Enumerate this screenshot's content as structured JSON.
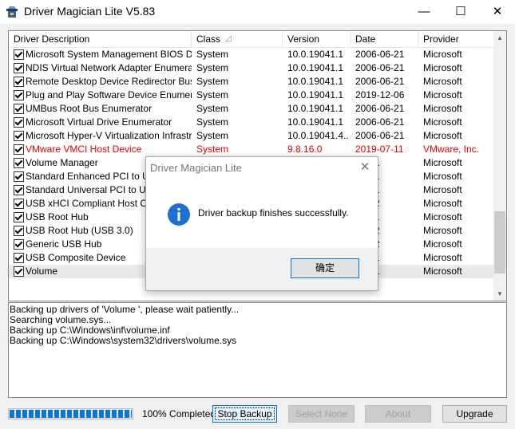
{
  "window": {
    "title": "Driver Magician Lite V5.83",
    "minimize_glyph": "—",
    "maximize_glyph": "☐",
    "close_glyph": "✕"
  },
  "list": {
    "headers": {
      "desc": "Driver Description",
      "class": "Class",
      "version": "Version",
      "date": "Date",
      "provider": "Provider"
    },
    "sort_glyph": "◿",
    "rows": [
      {
        "desc": "Microsoft System Management BIOS Driver",
        "class": "System",
        "version": "10.0.19041.1",
        "date": "2006-06-21",
        "provider": "Microsoft"
      },
      {
        "desc": "NDIS Virtual Network Adapter Enumerator",
        "class": "System",
        "version": "10.0.19041.1",
        "date": "2006-06-21",
        "provider": "Microsoft"
      },
      {
        "desc": "Remote Desktop Device Redirector Bus",
        "class": "System",
        "version": "10.0.19041.1",
        "date": "2006-06-21",
        "provider": "Microsoft"
      },
      {
        "desc": "Plug and Play Software Device Enumerator",
        "class": "System",
        "version": "10.0.19041.1",
        "date": "2019-12-06",
        "provider": "Microsoft"
      },
      {
        "desc": "UMBus Root Bus Enumerator",
        "class": "System",
        "version": "10.0.19041.1",
        "date": "2006-06-21",
        "provider": "Microsoft"
      },
      {
        "desc": "Microsoft Virtual Drive Enumerator",
        "class": "System",
        "version": "10.0.19041.1",
        "date": "2006-06-21",
        "provider": "Microsoft"
      },
      {
        "desc": "Microsoft Hyper-V Virtualization Infrastruct...",
        "class": "System",
        "version": "10.0.19041.4...",
        "date": "2006-06-21",
        "provider": "Microsoft"
      },
      {
        "desc": "VMware VMCI Host Device",
        "class": "System",
        "version": "9.8.16.0",
        "date": "2019-07-11",
        "provider": "VMware, Inc.",
        "warn": true
      },
      {
        "desc": "Volume Manager",
        "class": "",
        "version": "",
        "date": "06-21",
        "provider": "Microsoft"
      },
      {
        "desc": "Standard Enhanced PCI to USB",
        "class": "",
        "version": "",
        "date": "06-21",
        "provider": "Microsoft"
      },
      {
        "desc": "Standard Universal PCI to USB",
        "class": "",
        "version": "",
        "date": "06-21",
        "provider": "Microsoft"
      },
      {
        "desc": "USB xHCI Compliant Host Contr",
        "class": "",
        "version": "",
        "date": "04-12",
        "provider": "Microsoft"
      },
      {
        "desc": "USB Root Hub",
        "class": "",
        "version": "",
        "date": "06-21",
        "provider": "Microsoft"
      },
      {
        "desc": "USB Root Hub (USB 3.0)",
        "class": "",
        "version": "",
        "date": "04-12",
        "provider": "Microsoft"
      },
      {
        "desc": "Generic USB Hub",
        "class": "",
        "version": "",
        "date": "04-12",
        "provider": "Microsoft"
      },
      {
        "desc": "USB Composite Device",
        "class": "",
        "version": "",
        "date": "06-21",
        "provider": "Microsoft"
      },
      {
        "desc": "Volume",
        "class": "",
        "version": "",
        "date": "06-21",
        "provider": "Microsoft",
        "selected": true
      }
    ]
  },
  "scrollbar": {
    "up_glyph": "▲",
    "down_glyph": "▼"
  },
  "log": {
    "lines": [
      "Backing up drivers of  'Volume ', please wait patiently...",
      "Searching volume.sys...",
      "Backing up C:\\Windows\\inf\\volume.inf",
      "Backing up C:\\Windows\\system32\\drivers\\volume.sys"
    ]
  },
  "status": {
    "progress_percent": 100,
    "progress_text": "100% Completed"
  },
  "buttons": {
    "stop_backup": "Stop Backup",
    "select_none": "Select None",
    "about": "About",
    "upgrade": "Upgrade"
  },
  "dialog": {
    "title": "Driver Magician Lite",
    "close_glyph": "✕",
    "message": "Driver backup finishes successfully.",
    "ok_label": "确定"
  },
  "colors": {
    "info_icon": "#1d6fd1",
    "warn_text": "#e60000",
    "progress": "#0b75d4"
  }
}
